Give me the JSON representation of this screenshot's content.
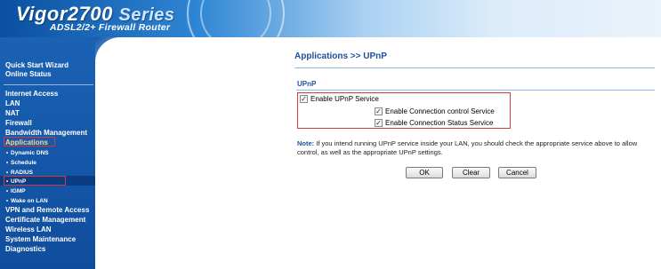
{
  "header": {
    "brand": "Vigor2700",
    "series": "Series",
    "subtitle": "ADSL2/2+ Firewall Router"
  },
  "sidebar": {
    "top_items": [
      "Quick Start Wizard",
      "Online Status"
    ],
    "main_items": [
      "Internet Access",
      "LAN",
      "NAT",
      "Firewall",
      "Bandwidth Management",
      "Applications"
    ],
    "sub_items": [
      "Dynamic DNS",
      "Schedule",
      "RADIUS",
      "UPnP",
      "IGMP",
      "Wake on LAN"
    ],
    "bottom_items": [
      "VPN and Remote Access",
      "Certificate Management",
      "Wireless LAN",
      "System Maintenance",
      "Diagnostics"
    ]
  },
  "page": {
    "breadcrumb": "Applications >> UPnP",
    "section_title": "UPnP",
    "options": {
      "enable_upnp": {
        "label": "Enable UPnP Service",
        "checked": true
      },
      "enable_conn_control": {
        "label": "Enable Connection control Service",
        "checked": true
      },
      "enable_conn_status": {
        "label": "Enable Connection Status Service",
        "checked": true
      }
    },
    "note_label": "Note:",
    "note_text": " If you intend running UPnP service inside your LAN, you should check the appropriate service above to allow control, as well as the appropriate UPnP settings."
  },
  "buttons": {
    "ok": "OK",
    "clear": "Clear",
    "cancel": "Cancel"
  },
  "colors": {
    "accent": "#1f4f9a",
    "highlight_border": "#d23b3b",
    "sidebar_bg": "#1557a8"
  }
}
